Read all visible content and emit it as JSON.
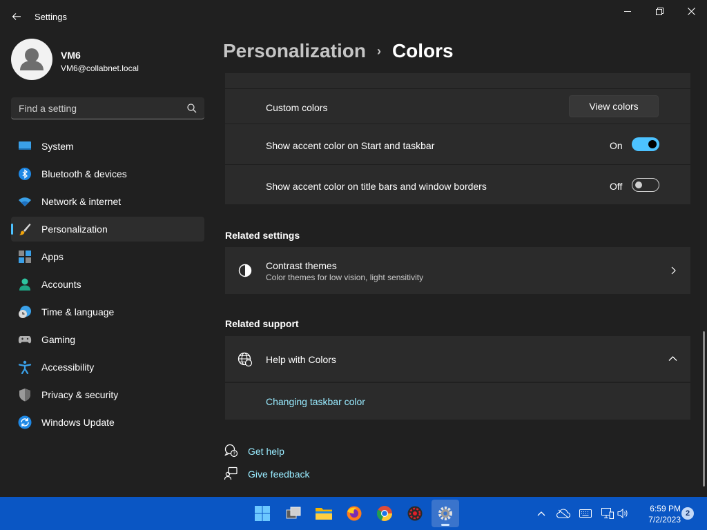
{
  "window": {
    "title": "Settings",
    "back_icon": "back-arrow-icon",
    "controls": [
      "minimize-icon",
      "restore-icon",
      "close-icon"
    ]
  },
  "profile": {
    "name": "VM6",
    "email": "VM6@collabnet.local"
  },
  "search": {
    "placeholder": "Find a setting",
    "icon": "search-icon"
  },
  "sidebar": {
    "items": [
      {
        "label": "System",
        "icon": "system-icon"
      },
      {
        "label": "Bluetooth & devices",
        "icon": "bluetooth-icon"
      },
      {
        "label": "Network & internet",
        "icon": "wifi-icon"
      },
      {
        "label": "Personalization",
        "icon": "brush-icon",
        "active": true
      },
      {
        "label": "Apps",
        "icon": "apps-icon"
      },
      {
        "label": "Accounts",
        "icon": "accounts-icon"
      },
      {
        "label": "Time & language",
        "icon": "clock-globe-icon"
      },
      {
        "label": "Gaming",
        "icon": "gamepad-icon"
      },
      {
        "label": "Accessibility",
        "icon": "accessibility-icon"
      },
      {
        "label": "Privacy & security",
        "icon": "shield-icon"
      },
      {
        "label": "Windows Update",
        "icon": "update-icon"
      }
    ]
  },
  "breadcrumb": {
    "parent": "Personalization",
    "separator": "›",
    "current": "Colors"
  },
  "colors_card": {
    "custom_colors_label": "Custom colors",
    "view_colors_button": "View colors",
    "accent_start_label": "Show accent color on Start and taskbar",
    "accent_start_state": "On",
    "accent_title_label": "Show accent color on title bars and window borders",
    "accent_title_state": "Off"
  },
  "related_settings": {
    "title": "Related settings",
    "contrast_title": "Contrast themes",
    "contrast_sub": "Color themes for low vision, light sensitivity"
  },
  "related_support": {
    "title": "Related support",
    "help_title": "Help with Colors",
    "help_link": "Changing taskbar color"
  },
  "footer_links": {
    "get_help": "Get help",
    "give_feedback": "Give feedback"
  },
  "taskbar": {
    "apps": [
      "start-icon",
      "task-view-icon",
      "file-explorer-icon",
      "firefox-icon",
      "chrome-icon",
      "app-red-icon",
      "settings-icon"
    ],
    "tray": [
      "chevron-up-icon",
      "onedrive-icon",
      "keyboard-icon",
      "network-icon",
      "volume-icon"
    ],
    "time": "6:59 PM",
    "date": "7/2/2023",
    "notifications": "2"
  },
  "colors": {
    "accent": "#4cc2ff",
    "link": "#99ebff",
    "background": "#202020",
    "card": "#2b2b2b",
    "taskbar": "#0a56c4"
  }
}
